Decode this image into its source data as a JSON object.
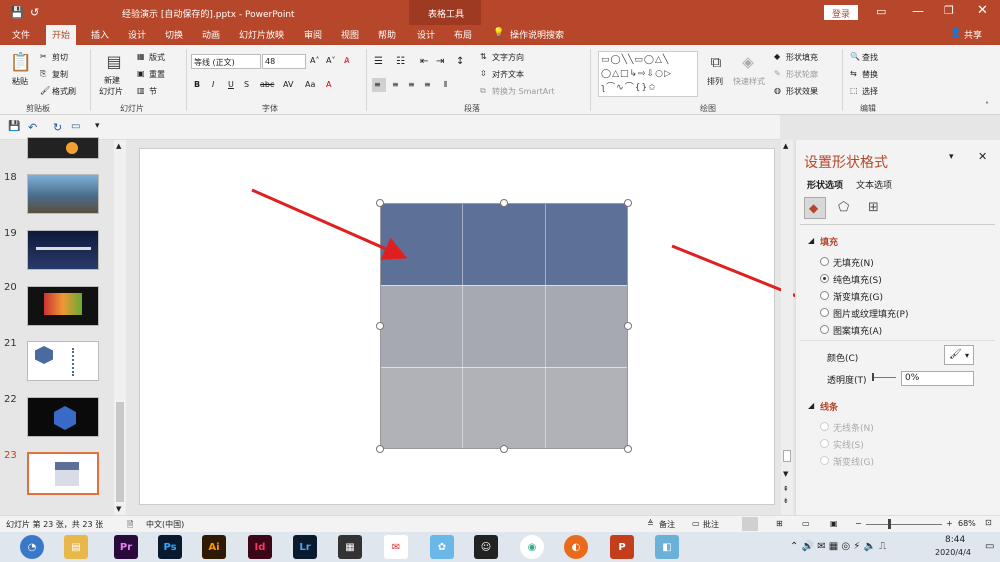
{
  "titlebar": {
    "doc_title": "经验演示 [自动保存的].pptx - PowerPoint",
    "context_tab": "表格工具",
    "login": "登录"
  },
  "tabs": [
    "文件",
    "开始",
    "插入",
    "设计",
    "切换",
    "动画",
    "幻灯片放映",
    "审阅",
    "视图",
    "帮助",
    "设计",
    "布局",
    "操作说明搜索",
    "共享"
  ],
  "ribbon": {
    "clipboard": {
      "paste": "粘贴",
      "cut": "剪切",
      "copy": "复制",
      "format_painter": "格式刷",
      "label": "剪贴板"
    },
    "slides": {
      "new_slide_1": "新建",
      "new_slide_2": "幻灯片",
      "layout": "版式",
      "reset": "重置",
      "section": "节",
      "label": "幻灯片"
    },
    "font": {
      "name": "等线 (正文)",
      "size": "48",
      "label": "字体"
    },
    "paragraph": {
      "text_direction": "文字方向",
      "align_text": "对齐文本",
      "smartart": "转换为 SmartArt",
      "label": "段落"
    },
    "drawing": {
      "arrange": "排列",
      "quick_styles": "快速样式",
      "shape_fill": "形状填充",
      "shape_outline": "形状轮廓",
      "shape_effects": "形状效果",
      "label": "绘图"
    },
    "editing": {
      "find": "查找",
      "replace": "替换",
      "select": "选择",
      "label": "编辑"
    }
  },
  "slides_panel": {
    "numbers": [
      "18",
      "19",
      "20",
      "21",
      "22",
      "23"
    ]
  },
  "format_pane": {
    "title": "设置形状格式",
    "tab_shape": "形状选项",
    "tab_text": "文本选项",
    "fill_section": "填充",
    "fill_options": [
      "无填充(N)",
      "纯色填充(S)",
      "渐变填充(G)",
      "图片或纹理填充(P)",
      "图案填充(A)"
    ],
    "selected_fill": "纯色填充(S)",
    "color_label": "颜色(C)",
    "transparency_label": "透明度(T)",
    "transparency_value": "0%",
    "line_section": "线条",
    "line_options": [
      "无线条(N)",
      "实线(S)",
      "渐变线(G)"
    ]
  },
  "status": {
    "slide_info": "幻灯片 第 23 张，共 23 张",
    "language": "中文(中国)",
    "notes": "备注",
    "comments": "批注",
    "zoom": "68%"
  },
  "table": {
    "colors": {
      "top": "#5c7098",
      "mid": "#a6a9b2",
      "bottom": "#b0b2b8"
    }
  },
  "taskbar": {
    "time": "8:44",
    "date": "2020/4/4",
    "apps": [
      "Pr",
      "Ps",
      "Ai",
      "Id",
      "Lr"
    ]
  }
}
